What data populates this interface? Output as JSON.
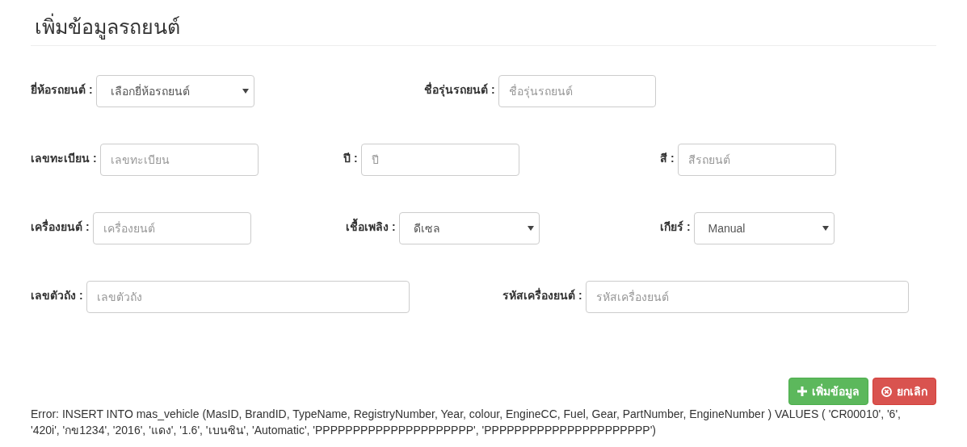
{
  "title": "เพิ่มข้อมูลรถยนต์",
  "rows": [
    [
      {
        "label": "ยี่ห้อรถยนต์ :",
        "kind": "select",
        "value": "เลือกยี่ห้อรถยนต์"
      },
      {
        "label": "ชื่อรุ่นรถยนต์ :",
        "kind": "input",
        "placeholder": "ชื่อรุ่นรถยนต์"
      }
    ],
    [
      {
        "label": "เลขทะเบียน :",
        "kind": "input",
        "placeholder": "เลขทะเบียน"
      },
      {
        "label": "ปี :",
        "kind": "input",
        "placeholder": "ปี"
      },
      {
        "label": "สี :",
        "kind": "input",
        "placeholder": "สีรถยนต์"
      }
    ],
    [
      {
        "label": "เครื่องยนต์ :",
        "kind": "input",
        "placeholder": "เครื่องยนต์"
      },
      {
        "label": "เชื้อเพลิง :",
        "kind": "select",
        "value": "ดีเซล"
      },
      {
        "label": "เกียร์ :",
        "kind": "select",
        "value": "Manual"
      }
    ],
    [
      {
        "label": "เลขตัวถัง :",
        "kind": "input",
        "placeholder": "เลขตัวถัง"
      },
      {
        "label": "รหัสเครื่องยนต์ :",
        "kind": "input",
        "placeholder": "รหัสเครื่องยนต์"
      }
    ]
  ],
  "buttons": [
    {
      "label": "เพิ่มข้อมูล",
      "kind": "add"
    },
    {
      "label": "ยกเลิก",
      "kind": "cancel"
    }
  ],
  "error": "Error: INSERT INTO mas_vehicle (MasID, BrandID, TypeName, RegistryNumber, Year, colour, EngineCC, Fuel, Gear, PartNumber, EngineNumber ) VALUES ( 'CR00010', '6', '420i', 'กข1234', '2016', 'แดง', '1.6', 'เบนซิน', 'Automatic', 'PPPPPPPPPPPPPPPPPPPPP', 'PPPPPPPPPPPPPPPPPPPPPP')"
}
